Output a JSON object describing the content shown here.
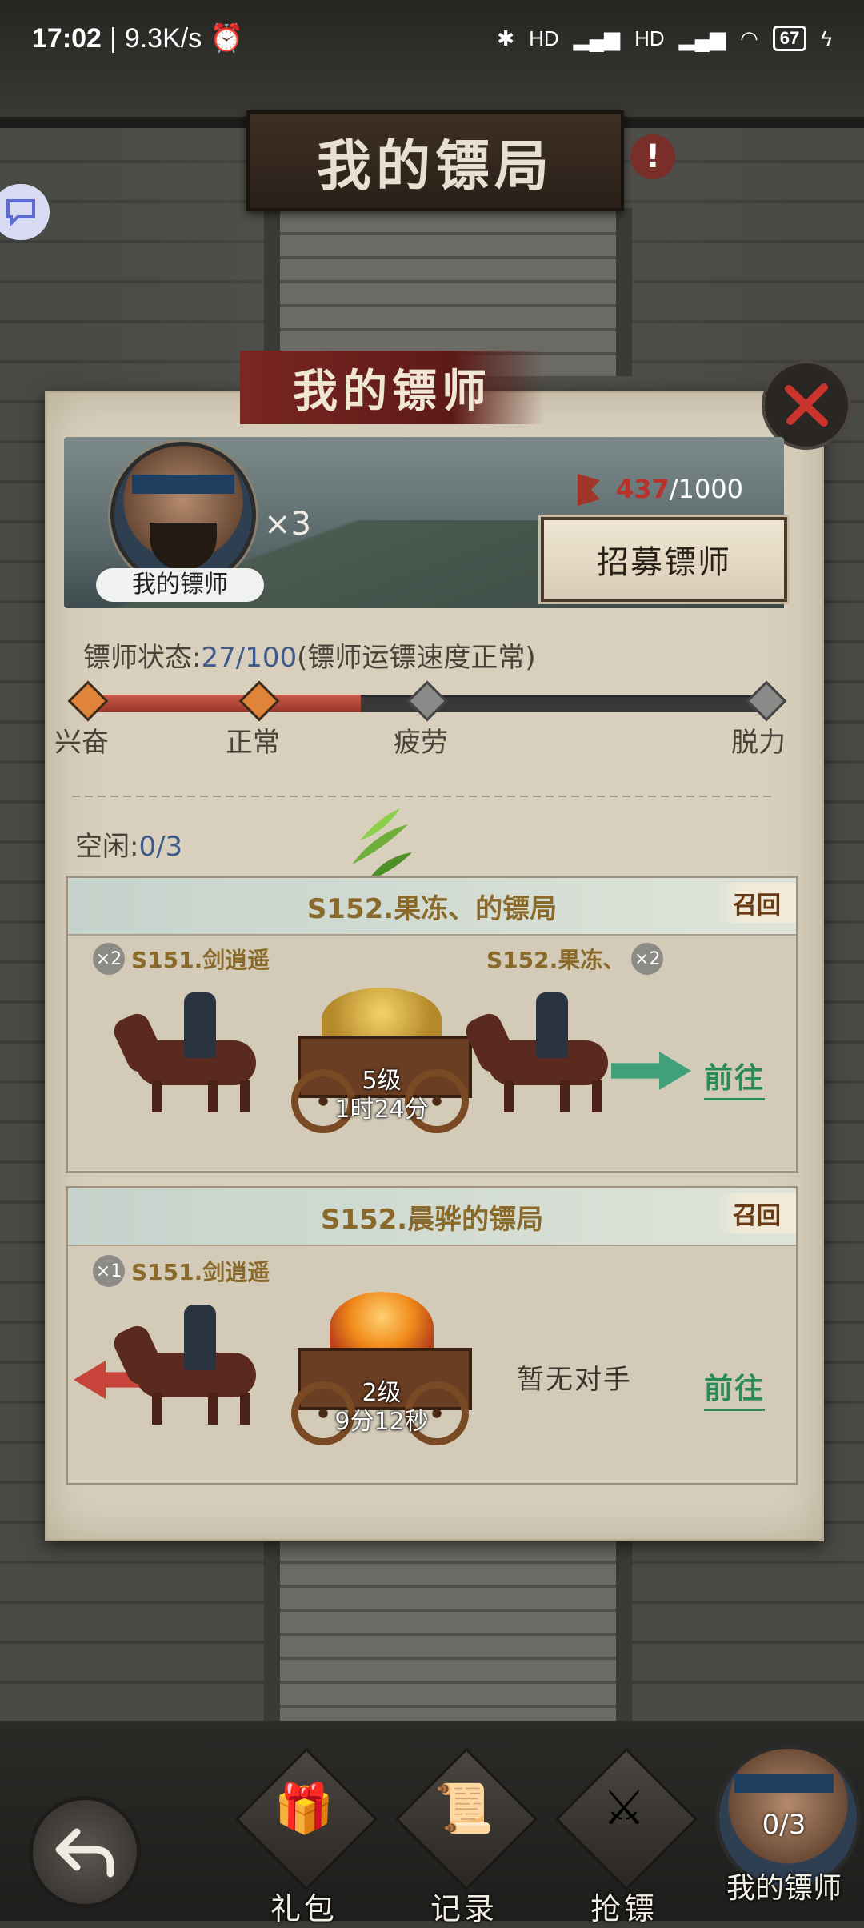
{
  "status_bar": {
    "time": "17:02",
    "net_speed": "9.3K/s",
    "signal1": "HD",
    "signal2": "HD",
    "battery": "67"
  },
  "header": {
    "title": "我的镖局"
  },
  "panel": {
    "title": "我的镖师",
    "avatar_label": "我的镖师",
    "multiplier": "×3",
    "recruit_current": "437",
    "recruit_max": "/1000",
    "recruit_button": "招募镖师",
    "status_label": "镖师状态:",
    "status_value": "27/100",
    "status_note": "(镖师运镖速度正常)",
    "status_fill": 0.27,
    "bar_labels": [
      "兴奋",
      "正常",
      "疲劳",
      "脱力"
    ],
    "idle_label": "空闲:",
    "idle_value": "0/3"
  },
  "escorts": [
    {
      "title": "S152.果冻、的镖局",
      "recall": "召回",
      "left_count": "×2",
      "left_name": "S151.剑逍遥",
      "right_name": "S152.果冻、",
      "right_count": "×2",
      "level": "5级",
      "time_left": "1时24分",
      "goto": "前往"
    },
    {
      "title": "S152.晨骅的镖局",
      "recall": "召回",
      "left_count": "×1",
      "left_name": "S151.剑逍遥",
      "level": "2级",
      "time_left": "9分12秒",
      "no_opponent": "暂无对手",
      "goto": "前往"
    }
  ],
  "bottom_nav": {
    "gift": "礼包",
    "record": "记录",
    "rob": "抢镖",
    "my_escort": "我的镖师",
    "my_escort_count": "0/3"
  },
  "colors": {
    "accent_red": "#b8312a",
    "go_green": "#2b8a5a",
    "gold_text": "#8a6a2a"
  }
}
